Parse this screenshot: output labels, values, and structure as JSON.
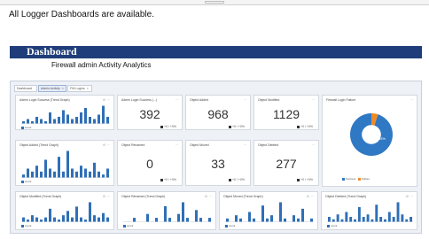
{
  "headline": "All Logger Dashboards are available.",
  "banner": {
    "title": "Dashboard",
    "subtitle": "Firewall admin Activity Analytics"
  },
  "colors": {
    "banner": "#1f3d7a",
    "bar": "#2f6fb6",
    "pie_primary": "#2f78c4",
    "pie_secondary": "#f08a24"
  },
  "tabs": [
    {
      "label": "Dashboard"
    },
    {
      "label": "Admin Activity"
    },
    {
      "label": "FW Logins"
    }
  ],
  "panels": {
    "admin_logins_trend": {
      "title": "Admin Login Success (Trend Graph)",
      "legend": "count"
    },
    "admin_logins_success": {
      "title": "Admin Login Success (...)",
      "value": "392",
      "delta": "+0 / +0%"
    },
    "object_added": {
      "title": "Object Added",
      "value": "968",
      "delta": "+0 / +0%"
    },
    "object_modified": {
      "title": "Object Modified",
      "value": "1129",
      "delta": "+0 / +0%"
    },
    "firewall_login_failure": {
      "title": "Firewall Login Failure",
      "legend_a": "Success",
      "legend_b": "Failure",
      "pie_label": "95%"
    },
    "object_added_trend": {
      "title": "Object Added (Trend Graph)",
      "legend": "count"
    },
    "object_renamed": {
      "title": "Object Renamed",
      "value": "0",
      "delta": "+0 / +0%"
    },
    "object_moved": {
      "title": "Object Moved",
      "value": "33",
      "delta": "+0 / +0%"
    },
    "object_deleted": {
      "title": "Object Deleted",
      "value": "277",
      "delta": "+0 / +0%"
    },
    "object_modified_trend": {
      "title": "Object Modified (Trend Graph)",
      "legend": "count"
    },
    "object_renamed_trend": {
      "title": "Object Renamed (Trend Graph)",
      "legend": "count"
    },
    "object_moved_trend": {
      "title": "Object Moved (Trend Graph)",
      "legend": "count"
    },
    "object_deleted_trend": {
      "title": "Object Deleted (Trend Graph)",
      "legend": "count"
    }
  },
  "chart_data": [
    {
      "type": "bar",
      "series": [
        {
          "values": [
            1,
            2,
            1,
            3,
            2,
            1,
            5,
            2,
            3,
            6,
            4,
            2,
            3,
            5,
            7,
            3,
            2,
            4,
            8,
            3
          ]
        }
      ]
    },
    {
      "type": "bar",
      "series": [
        {
          "values": [
            1,
            3,
            2,
            4,
            2,
            6,
            3,
            2,
            7,
            2,
            9,
            3,
            2,
            4,
            3,
            2,
            5,
            2,
            1,
            3
          ]
        }
      ]
    },
    {
      "type": "bar",
      "series": [
        {
          "values": [
            2,
            1,
            3,
            2,
            1,
            2,
            6,
            2,
            1,
            3,
            5,
            2,
            7,
            2,
            1,
            9,
            3,
            2,
            4,
            2
          ]
        }
      ]
    },
    {
      "type": "bar",
      "series": [
        {
          "values": [
            0,
            0,
            1,
            0,
            0,
            2,
            0,
            1,
            0,
            4,
            1,
            0,
            2,
            5,
            1,
            0,
            3,
            1,
            0,
            1
          ]
        }
      ]
    },
    {
      "type": "bar",
      "series": [
        {
          "values": [
            1,
            0,
            2,
            1,
            0,
            3,
            1,
            0,
            5,
            1,
            2,
            0,
            6,
            1,
            0,
            2,
            1,
            4,
            0,
            1
          ]
        }
      ]
    },
    {
      "type": "bar",
      "series": [
        {
          "values": [
            2,
            1,
            3,
            1,
            4,
            2,
            1,
            6,
            2,
            3,
            1,
            7,
            2,
            1,
            4,
            2,
            8,
            3,
            1,
            2
          ]
        }
      ]
    },
    {
      "type": "pie",
      "values": [
        95,
        5
      ]
    }
  ]
}
